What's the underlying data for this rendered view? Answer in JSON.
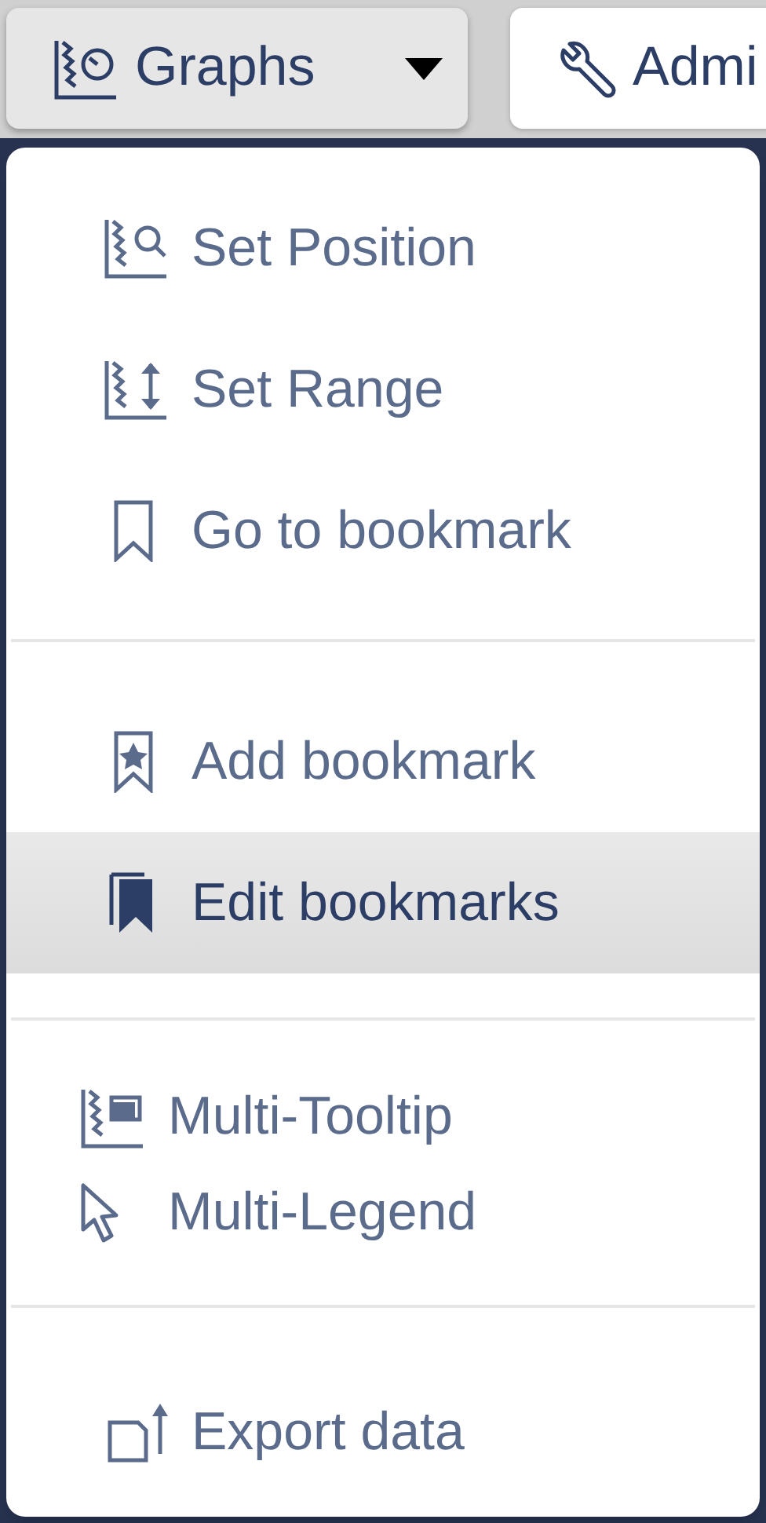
{
  "toolbar": [
    {
      "label": "Graphs",
      "kind": "dropdown",
      "pressed": true
    },
    {
      "label": "Admi",
      "kind": "button",
      "pressed": false
    }
  ],
  "menu": {
    "sections": [
      {
        "items": [
          {
            "label": "Set Position",
            "kind": "action",
            "selected": false
          },
          {
            "label": "Set Range",
            "kind": "action",
            "selected": false
          },
          {
            "label": "Go to bookmark",
            "kind": "action",
            "selected": false
          }
        ]
      },
      {
        "items": [
          {
            "label": "Add bookmark",
            "kind": "action",
            "selected": false
          },
          {
            "label": "Edit bookmarks",
            "kind": "action",
            "selected": true
          }
        ]
      },
      {
        "items": [
          {
            "label": "Multi-Tooltip",
            "kind": "toggle",
            "selected": false
          },
          {
            "label": "Multi-Legend",
            "kind": "toggle",
            "selected": false
          }
        ]
      },
      {
        "items": [
          {
            "label": "Export data",
            "kind": "action",
            "selected": false
          }
        ]
      }
    ]
  }
}
